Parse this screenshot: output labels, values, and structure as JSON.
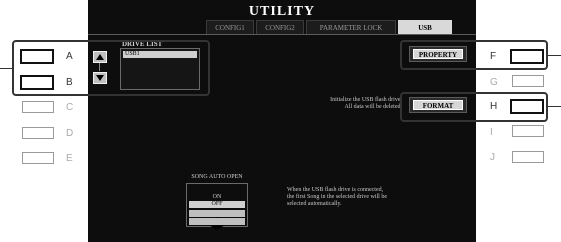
{
  "window": {
    "title": "UTILITY"
  },
  "tabs": [
    {
      "label": "CONFIG1",
      "active": false
    },
    {
      "label": "CONFIG2",
      "active": false
    },
    {
      "label": "PARAMETER LOCK",
      "active": false
    },
    {
      "label": "USB",
      "active": true
    }
  ],
  "drive_list": {
    "label": "DRIVE LIST",
    "items": [
      "USB1"
    ],
    "selected": "USB1"
  },
  "property_button": {
    "label": "PROPERTY"
  },
  "format_button": {
    "label": "FORMAT"
  },
  "format_info": {
    "line1": "Initialize the USB flash drive.",
    "line2": "All data will be deleted."
  },
  "song_auto_open": {
    "label": "SONG AUTO OPEN",
    "options": [
      "ON",
      "OFF"
    ],
    "selected": "OFF",
    "note": [
      "When the USB flash drive is connected,",
      "the first Song in the selected drive will be",
      "selected automatically."
    ]
  },
  "left_buttons": [
    {
      "letter": "A",
      "active": true
    },
    {
      "letter": "B",
      "active": true
    },
    {
      "letter": "C",
      "active": false
    },
    {
      "letter": "D",
      "active": false
    },
    {
      "letter": "E",
      "active": false
    }
  ],
  "right_buttons": [
    {
      "letter": "F",
      "active": true
    },
    {
      "letter": "G",
      "active": false
    },
    {
      "letter": "H",
      "active": true
    },
    {
      "letter": "I",
      "active": false
    },
    {
      "letter": "J",
      "active": false
    }
  ],
  "icons": {
    "up": "up-arrow-icon",
    "down": "down-arrow-icon"
  }
}
